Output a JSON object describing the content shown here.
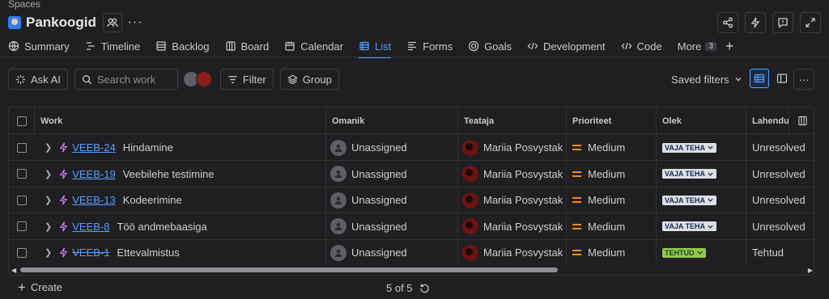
{
  "breadcrumb": "Spaces",
  "project": {
    "name": "Pankoogid"
  },
  "tabs": [
    {
      "label": "Summary",
      "icon": "globe-icon"
    },
    {
      "label": "Timeline",
      "icon": "timeline-icon"
    },
    {
      "label": "Backlog",
      "icon": "backlog-icon"
    },
    {
      "label": "Board",
      "icon": "board-icon"
    },
    {
      "label": "Calendar",
      "icon": "calendar-icon"
    },
    {
      "label": "List",
      "icon": "list-icon",
      "active": true
    },
    {
      "label": "Forms",
      "icon": "forms-icon"
    },
    {
      "label": "Goals",
      "icon": "goals-icon"
    },
    {
      "label": "Development",
      "icon": "development-icon"
    },
    {
      "label": "Code",
      "icon": "code-icon"
    },
    {
      "label": "More",
      "count": "3"
    }
  ],
  "toolbar": {
    "ask_ai": "Ask AI",
    "search_placeholder": "Search work",
    "filter": "Filter",
    "group": "Group",
    "saved_filters": "Saved filters"
  },
  "columns": {
    "work": "Work",
    "owner": "Omanik",
    "reporter": "Teataja",
    "priority": "Prioriteet",
    "status": "Olek",
    "resolution": "Lahendus"
  },
  "rows": [
    {
      "key": "VEEB-24",
      "summary": "Hindamine",
      "owner": "Unassigned",
      "reporter": "Mariia Posvystak",
      "priority": "Medium",
      "status": "VAJA TEHA",
      "resolution": "Unresolved",
      "done": false
    },
    {
      "key": "VEEB-19",
      "summary": "Veebilehe testimine",
      "owner": "Unassigned",
      "reporter": "Mariia Posvystak",
      "priority": "Medium",
      "status": "VAJA TEHA",
      "resolution": "Unresolved",
      "done": false
    },
    {
      "key": "VEEB-13",
      "summary": "Kodeerimine",
      "owner": "Unassigned",
      "reporter": "Mariia Posvystak",
      "priority": "Medium",
      "status": "VAJA TEHA",
      "resolution": "Unresolved",
      "done": false
    },
    {
      "key": "VEEB-8",
      "summary": "Töö andmebaasiga",
      "owner": "Unassigned",
      "reporter": "Mariia Posvystak",
      "priority": "Medium",
      "status": "VAJA TEHA",
      "resolution": "Unresolved",
      "done": false
    },
    {
      "key": "VEEB-1",
      "summary": "Ettevalmistus",
      "owner": "Unassigned",
      "reporter": "Mariia Posvystak",
      "priority": "Medium",
      "status": "TEHTUD",
      "resolution": "Tehtud",
      "done": true
    }
  ],
  "footer": {
    "create": "Create",
    "count": "5 of 5"
  },
  "colors": {
    "accent": "#579dff",
    "priority_medium": "#f18d13",
    "status_done": "#94c748",
    "status_todo": "#dcdfe4",
    "bolt": "#c97cf4"
  }
}
